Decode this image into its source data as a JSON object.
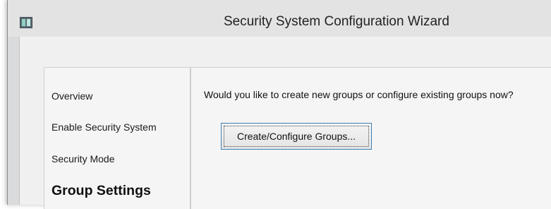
{
  "window": {
    "title": "Security System Configuration Wizard",
    "icon": "wizard-app-icon"
  },
  "nav": {
    "items": [
      {
        "label": "Overview",
        "active": false
      },
      {
        "label": "Enable Security System",
        "active": false
      },
      {
        "label": "Security Mode",
        "active": false
      },
      {
        "label": "Group Settings",
        "active": true
      }
    ]
  },
  "content": {
    "question": "Would you like to create new groups or configure existing groups now?",
    "button_label": "Create/Configure Groups..."
  }
}
